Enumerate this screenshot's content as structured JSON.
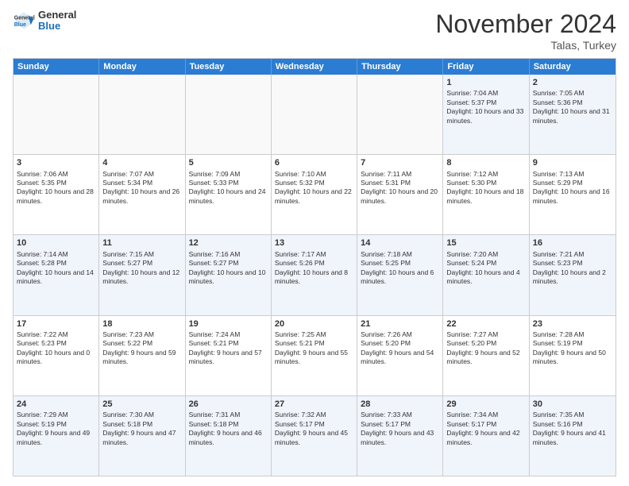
{
  "header": {
    "logo_general": "General",
    "logo_blue": "Blue",
    "month": "November 2024",
    "location": "Talas, Turkey"
  },
  "days_of_week": [
    "Sunday",
    "Monday",
    "Tuesday",
    "Wednesday",
    "Thursday",
    "Friday",
    "Saturday"
  ],
  "rows": [
    [
      {
        "day": "",
        "empty": true
      },
      {
        "day": "",
        "empty": true
      },
      {
        "day": "",
        "empty": true
      },
      {
        "day": "",
        "empty": true
      },
      {
        "day": "",
        "empty": true
      },
      {
        "day": "1",
        "sunrise": "Sunrise: 7:04 AM",
        "sunset": "Sunset: 5:37 PM",
        "daylight": "Daylight: 10 hours and 33 minutes."
      },
      {
        "day": "2",
        "sunrise": "Sunrise: 7:05 AM",
        "sunset": "Sunset: 5:36 PM",
        "daylight": "Daylight: 10 hours and 31 minutes."
      }
    ],
    [
      {
        "day": "3",
        "sunrise": "Sunrise: 7:06 AM",
        "sunset": "Sunset: 5:35 PM",
        "daylight": "Daylight: 10 hours and 28 minutes."
      },
      {
        "day": "4",
        "sunrise": "Sunrise: 7:07 AM",
        "sunset": "Sunset: 5:34 PM",
        "daylight": "Daylight: 10 hours and 26 minutes."
      },
      {
        "day": "5",
        "sunrise": "Sunrise: 7:09 AM",
        "sunset": "Sunset: 5:33 PM",
        "daylight": "Daylight: 10 hours and 24 minutes."
      },
      {
        "day": "6",
        "sunrise": "Sunrise: 7:10 AM",
        "sunset": "Sunset: 5:32 PM",
        "daylight": "Daylight: 10 hours and 22 minutes."
      },
      {
        "day": "7",
        "sunrise": "Sunrise: 7:11 AM",
        "sunset": "Sunset: 5:31 PM",
        "daylight": "Daylight: 10 hours and 20 minutes."
      },
      {
        "day": "8",
        "sunrise": "Sunrise: 7:12 AM",
        "sunset": "Sunset: 5:30 PM",
        "daylight": "Daylight: 10 hours and 18 minutes."
      },
      {
        "day": "9",
        "sunrise": "Sunrise: 7:13 AM",
        "sunset": "Sunset: 5:29 PM",
        "daylight": "Daylight: 10 hours and 16 minutes."
      }
    ],
    [
      {
        "day": "10",
        "sunrise": "Sunrise: 7:14 AM",
        "sunset": "Sunset: 5:28 PM",
        "daylight": "Daylight: 10 hours and 14 minutes."
      },
      {
        "day": "11",
        "sunrise": "Sunrise: 7:15 AM",
        "sunset": "Sunset: 5:27 PM",
        "daylight": "Daylight: 10 hours and 12 minutes."
      },
      {
        "day": "12",
        "sunrise": "Sunrise: 7:16 AM",
        "sunset": "Sunset: 5:27 PM",
        "daylight": "Daylight: 10 hours and 10 minutes."
      },
      {
        "day": "13",
        "sunrise": "Sunrise: 7:17 AM",
        "sunset": "Sunset: 5:26 PM",
        "daylight": "Daylight: 10 hours and 8 minutes."
      },
      {
        "day": "14",
        "sunrise": "Sunrise: 7:18 AM",
        "sunset": "Sunset: 5:25 PM",
        "daylight": "Daylight: 10 hours and 6 minutes."
      },
      {
        "day": "15",
        "sunrise": "Sunrise: 7:20 AM",
        "sunset": "Sunset: 5:24 PM",
        "daylight": "Daylight: 10 hours and 4 minutes."
      },
      {
        "day": "16",
        "sunrise": "Sunrise: 7:21 AM",
        "sunset": "Sunset: 5:23 PM",
        "daylight": "Daylight: 10 hours and 2 minutes."
      }
    ],
    [
      {
        "day": "17",
        "sunrise": "Sunrise: 7:22 AM",
        "sunset": "Sunset: 5:23 PM",
        "daylight": "Daylight: 10 hours and 0 minutes."
      },
      {
        "day": "18",
        "sunrise": "Sunrise: 7:23 AM",
        "sunset": "Sunset: 5:22 PM",
        "daylight": "Daylight: 9 hours and 59 minutes."
      },
      {
        "day": "19",
        "sunrise": "Sunrise: 7:24 AM",
        "sunset": "Sunset: 5:21 PM",
        "daylight": "Daylight: 9 hours and 57 minutes."
      },
      {
        "day": "20",
        "sunrise": "Sunrise: 7:25 AM",
        "sunset": "Sunset: 5:21 PM",
        "daylight": "Daylight: 9 hours and 55 minutes."
      },
      {
        "day": "21",
        "sunrise": "Sunrise: 7:26 AM",
        "sunset": "Sunset: 5:20 PM",
        "daylight": "Daylight: 9 hours and 54 minutes."
      },
      {
        "day": "22",
        "sunrise": "Sunrise: 7:27 AM",
        "sunset": "Sunset: 5:20 PM",
        "daylight": "Daylight: 9 hours and 52 minutes."
      },
      {
        "day": "23",
        "sunrise": "Sunrise: 7:28 AM",
        "sunset": "Sunset: 5:19 PM",
        "daylight": "Daylight: 9 hours and 50 minutes."
      }
    ],
    [
      {
        "day": "24",
        "sunrise": "Sunrise: 7:29 AM",
        "sunset": "Sunset: 5:19 PM",
        "daylight": "Daylight: 9 hours and 49 minutes."
      },
      {
        "day": "25",
        "sunrise": "Sunrise: 7:30 AM",
        "sunset": "Sunset: 5:18 PM",
        "daylight": "Daylight: 9 hours and 47 minutes."
      },
      {
        "day": "26",
        "sunrise": "Sunrise: 7:31 AM",
        "sunset": "Sunset: 5:18 PM",
        "daylight": "Daylight: 9 hours and 46 minutes."
      },
      {
        "day": "27",
        "sunrise": "Sunrise: 7:32 AM",
        "sunset": "Sunset: 5:17 PM",
        "daylight": "Daylight: 9 hours and 45 minutes."
      },
      {
        "day": "28",
        "sunrise": "Sunrise: 7:33 AM",
        "sunset": "Sunset: 5:17 PM",
        "daylight": "Daylight: 9 hours and 43 minutes."
      },
      {
        "day": "29",
        "sunrise": "Sunrise: 7:34 AM",
        "sunset": "Sunset: 5:17 PM",
        "daylight": "Daylight: 9 hours and 42 minutes."
      },
      {
        "day": "30",
        "sunrise": "Sunrise: 7:35 AM",
        "sunset": "Sunset: 5:16 PM",
        "daylight": "Daylight: 9 hours and 41 minutes."
      }
    ]
  ]
}
